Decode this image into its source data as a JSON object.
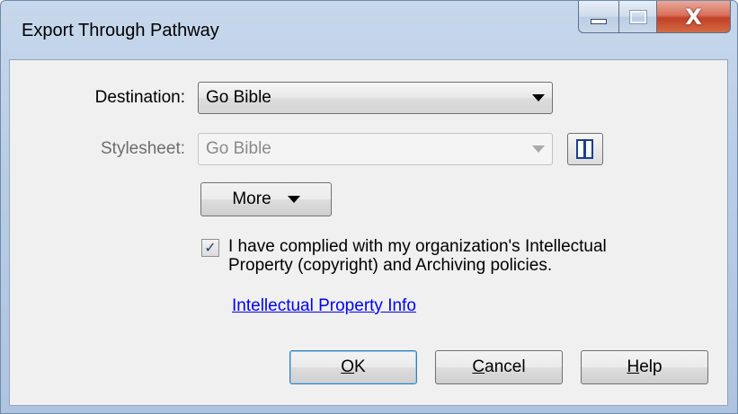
{
  "window": {
    "title": "Export Through Pathway",
    "caption_icons": [
      "minimize-icon",
      "maximize-icon",
      "close-icon"
    ],
    "close_glyph": "X"
  },
  "form": {
    "destination_label": "Destination:",
    "destination_value": "Go Bible",
    "stylesheet_label": "Stylesheet:",
    "stylesheet_value": "Go Bible",
    "stylesheet_enabled": false,
    "stylesheet_button_icon": "book-icon",
    "more_label": "More",
    "compliance_checked": true,
    "compliance_line1": "I have complied with my organization's Intellectual",
    "compliance_line2": "Property (copyright) and Archiving policies.",
    "ip_link": "Intellectual Property Info"
  },
  "buttons": {
    "ok_mnemonic": "O",
    "ok_rest": "K",
    "cancel_mnemonic": "C",
    "cancel_rest": "ancel",
    "help_mnemonic": "H",
    "help_rest": "elp"
  },
  "colors": {
    "link": "#0000ff",
    "frame": "#b9cde6",
    "client": "#f0f0f0",
    "close_button": "#c24127"
  }
}
